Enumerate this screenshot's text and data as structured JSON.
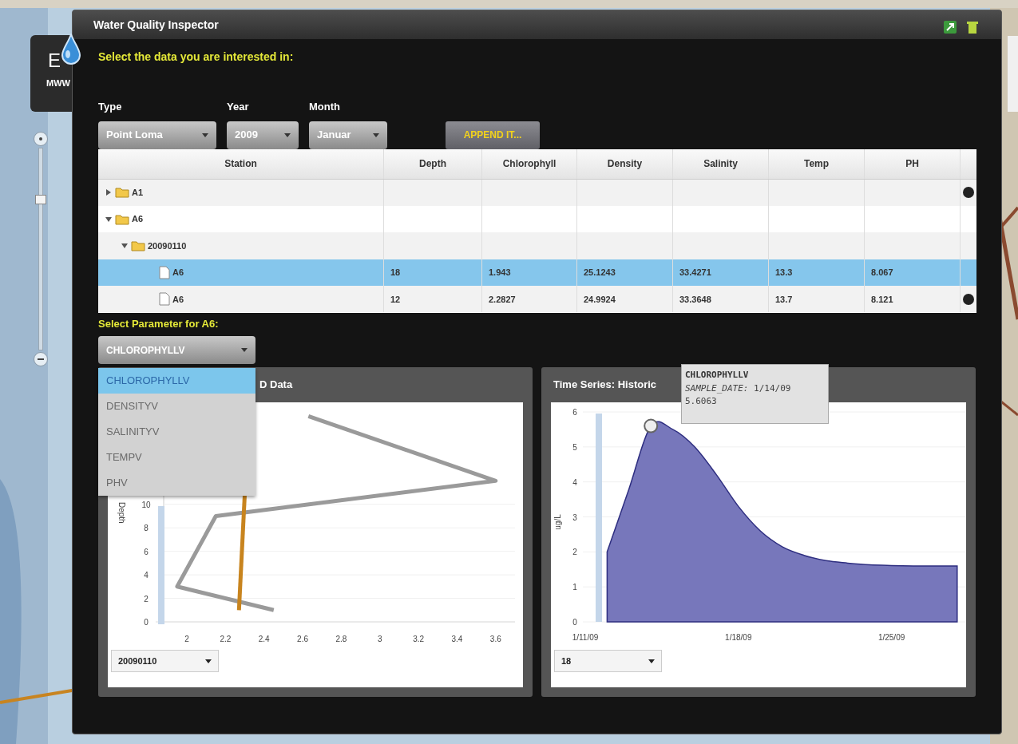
{
  "map_zoom": {
    "level": 0.76
  },
  "logo_panel": {
    "letter": "E",
    "caption": "MWW"
  },
  "window": {
    "title": "Water Quality Inspector"
  },
  "prompt": "Select the data you are interested in:",
  "filters": [
    {
      "label": "Type",
      "value": "Point Loma"
    },
    {
      "label": "Year",
      "value": "2009"
    },
    {
      "label": "Month",
      "value": "Januar"
    }
  ],
  "append_button": "APPEND IT...",
  "table": {
    "columns": [
      "Station",
      "Depth",
      "Chlorophyll",
      "Density",
      "Salinity",
      "Temp",
      "PH"
    ],
    "rows": [
      {
        "kind": "folder",
        "label": "A1",
        "expanded": false,
        "selected": false
      },
      {
        "kind": "folder",
        "label": "A6",
        "expanded": true,
        "selected": false,
        "children": [
          {
            "kind": "folder",
            "label": "20090110",
            "expanded": true,
            "selected": false,
            "children": [
              {
                "kind": "record",
                "label": "A6",
                "selected": true,
                "cells": [
                  "18",
                  "1.943",
                  "25.1243",
                  "33.4271",
                  "13.3",
                  "8.067"
                ]
              },
              {
                "kind": "record",
                "label": "A6",
                "selected": false,
                "cells": [
                  "12",
                  "2.2827",
                  "24.9924",
                  "33.3648",
                  "13.7",
                  "8.121"
                ]
              }
            ]
          }
        ]
      }
    ]
  },
  "parameter": {
    "label": "Select Parameter for A6:",
    "value": "CHLOROPHYLLV",
    "options": [
      {
        "label": "CHLOROPHYLLV",
        "selected": true
      },
      {
        "label": "DENSITYV",
        "selected": false
      },
      {
        "label": "SALINITYV",
        "selected": false
      },
      {
        "label": "TEMPV",
        "selected": false
      },
      {
        "label": "PHV",
        "selected": false
      }
    ]
  },
  "profile_chart": {
    "title": "D Data",
    "date_select": "20090110",
    "chart_data": {
      "type": "line",
      "ylabel": "Depth",
      "x": [
        2.45,
        1.95,
        2.15,
        3.6,
        2.63,
        2.27,
        2.3
      ],
      "series": [
        {
          "color": "#9a9a9a",
          "values": [
            1,
            3,
            9,
            12,
            17.5,
            null,
            null
          ]
        },
        {
          "color": "#c8841e",
          "values": [
            null,
            null,
            null,
            null,
            null,
            1,
            10.8
          ]
        }
      ],
      "xlim": [
        1.88,
        3.7
      ],
      "ylim": [
        0,
        18.2
      ],
      "grid": true,
      "xticks": [
        2,
        2.2,
        2.4,
        2.6,
        2.8,
        3,
        3.2,
        3.4,
        3.6
      ],
      "yticks": [
        0,
        2,
        4,
        6,
        8,
        10
      ]
    }
  },
  "time_series_chart": {
    "title": "Time Series: Historic",
    "depth_select": "18",
    "chart_data": {
      "type": "area",
      "ylabel": "ug/L",
      "categories": [
        "1/11/09",
        null,
        null,
        null,
        null,
        null,
        null,
        "1/18/09",
        null,
        null,
        null,
        null,
        null,
        null,
        "1/25/09",
        null,
        null,
        null
      ],
      "series": [
        {
          "color": "#7777bb",
          "values": [
            null,
            2.0,
            3.8,
            5.6,
            5.5,
            5.0,
            4.2,
            3.3,
            2.6,
            2.15,
            1.9,
            1.75,
            1.68,
            1.63,
            1.61,
            1.6,
            1.6,
            1.6
          ]
        }
      ],
      "ylim": [
        0,
        6
      ],
      "yticks": [
        0,
        1,
        2,
        3,
        4,
        5,
        6
      ],
      "grid": true
    },
    "tooltip": {
      "title": "CHLOROPHYLLV",
      "date_line": "*SAMPLE_DATE:* 1/14/09",
      "value": "5.6063"
    }
  }
}
